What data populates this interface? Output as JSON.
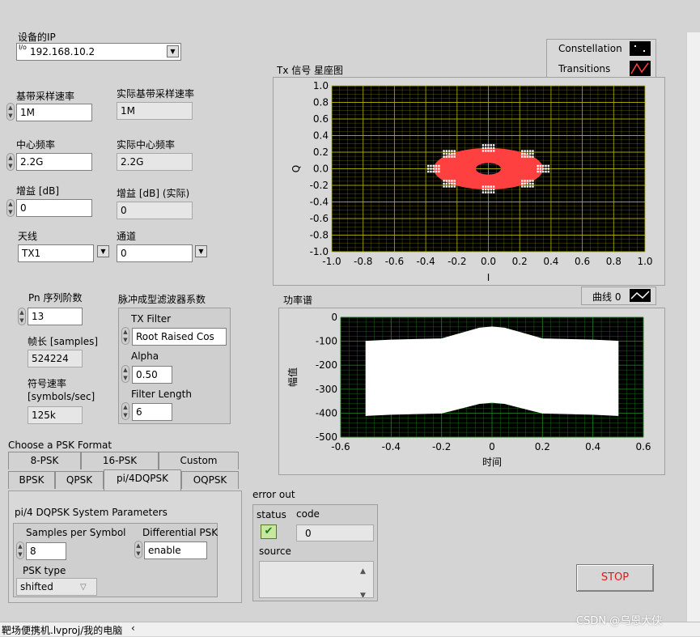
{
  "device_ip": {
    "label": "设备的IP",
    "prefix": "I/o",
    "value": "192.168.10.2"
  },
  "sample_rate": {
    "label": "基带采样速率",
    "value": "1M",
    "actual_label": "实际基带采样速率",
    "actual_value": "1M"
  },
  "center_freq": {
    "label": "中心频率",
    "value": "2.2G",
    "actual_label": "实际中心频率",
    "actual_value": "2.2G"
  },
  "gain": {
    "label": "增益 [dB]",
    "value": "0",
    "actual_label": "增益 [dB] (实际)",
    "actual_value": "0"
  },
  "antenna": {
    "label": "天线",
    "value": "TX1"
  },
  "channel": {
    "label": "通道",
    "value": "0"
  },
  "pn": {
    "label": "Pn 序列阶数",
    "value": "13",
    "frame_label": "帧长 [samples]",
    "frame_value": "524224",
    "symrate_label_1": "符号速率",
    "symrate_label_2": "[symbols/sec]",
    "symrate_value": "125k"
  },
  "filter": {
    "group_label": "脉冲成型滤波器系数",
    "tx_filter_label": "TX Filter",
    "tx_filter_value": "Root Raised Cos",
    "alpha_label": "Alpha",
    "alpha_value": "0.50",
    "length_label": "Filter Length",
    "length_value": "6"
  },
  "psk": {
    "choose_label": "Choose a PSK Format",
    "tabs_row1": [
      "8-PSK",
      "16-PSK",
      "Custom"
    ],
    "tabs_row2": [
      "BPSK",
      "QPSK",
      "pi/4DQPSK",
      "OQPSK"
    ],
    "params_title": "pi/4 DQPSK System Parameters",
    "sps_label": "Samples per Symbol",
    "sps_value": "8",
    "diff_label": "Differential PSK",
    "diff_value": "enable",
    "type_label": "PSK type",
    "type_value": "shifted"
  },
  "error_out": {
    "title": "error out",
    "status_label": "status",
    "code_label": "code",
    "code_value": "0",
    "source_label": "source"
  },
  "stop_label": "STOP",
  "constellation": {
    "title": "Tx 信号 星座图",
    "legend": [
      "Constellation",
      "Transitions"
    ],
    "xlabel": "I",
    "ylabel": "Q",
    "xticks": [
      "-1.0",
      "-0.8",
      "-0.6",
      "-0.4",
      "-0.2",
      "0.0",
      "0.2",
      "0.4",
      "0.6",
      "0.8",
      "1.0"
    ],
    "yticks": [
      "1.0",
      "0.8",
      "0.6",
      "0.4",
      "0.2",
      "0.0",
      "-0.2",
      "-0.4",
      "-0.6",
      "-0.8",
      "-1.0"
    ],
    "colors": {
      "bg": "#000000",
      "grid": "#b4b400",
      "transitions": "#ff4040",
      "points": "#ffffff"
    }
  },
  "spectrum": {
    "title": "功率谱",
    "legend": [
      "曲线 0"
    ],
    "xlabel": "时间",
    "ylabel": "幅值",
    "xticks": [
      "-0.6",
      "-0.4",
      "-0.2",
      "0",
      "0.2",
      "0.4",
      "0.6"
    ],
    "yticks": [
      "0",
      "-100",
      "-200",
      "-300",
      "-400",
      "-500"
    ],
    "colors": {
      "bg": "#000000",
      "grid": "#1f7a1f",
      "trace": "#ffffff"
    }
  },
  "statusbar": {
    "path": "靶场便携机.lvproj/我的电脑",
    "watermark": "CSDN @乌恩大侠"
  },
  "chart_data": [
    {
      "type": "scatter",
      "title": "Tx 信号 星座图",
      "xlabel": "I",
      "ylabel": "Q",
      "xlim": [
        -1.0,
        1.0
      ],
      "ylim": [
        -1.0,
        1.0
      ],
      "grid": true,
      "legend_position": "top-right",
      "series": [
        {
          "name": "Constellation",
          "x": [
            0.0,
            0.25,
            0.35,
            0.25,
            0.0,
            -0.25,
            -0.35,
            -0.25
          ],
          "y": [
            0.25,
            0.18,
            0.0,
            -0.18,
            -0.25,
            -0.18,
            0.0,
            0.18
          ]
        },
        {
          "name": "Transitions",
          "shape": "ring",
          "x_extent": [
            -0.35,
            0.35
          ],
          "y_extent": [
            -0.25,
            0.25
          ],
          "hole_x_extent": [
            -0.08,
            0.08
          ],
          "hole_y_extent": [
            -0.07,
            0.07
          ]
        }
      ]
    },
    {
      "type": "area",
      "title": "功率谱",
      "xlabel": "时间",
      "ylabel": "幅值",
      "xlim": [
        -0.6,
        0.6
      ],
      "ylim": [
        -500,
        0
      ],
      "grid": true,
      "legend_position": "top-right",
      "series": [
        {
          "name": "曲线 0",
          "x": [
            -0.5,
            -0.4,
            -0.2,
            -0.05,
            0.0,
            0.05,
            0.2,
            0.4,
            0.5
          ],
          "upper": [
            -100,
            -95,
            -90,
            -45,
            -40,
            -45,
            -90,
            -95,
            -100
          ],
          "lower": [
            -410,
            -405,
            -400,
            -360,
            -355,
            -360,
            -400,
            -405,
            -410
          ]
        }
      ]
    }
  ]
}
